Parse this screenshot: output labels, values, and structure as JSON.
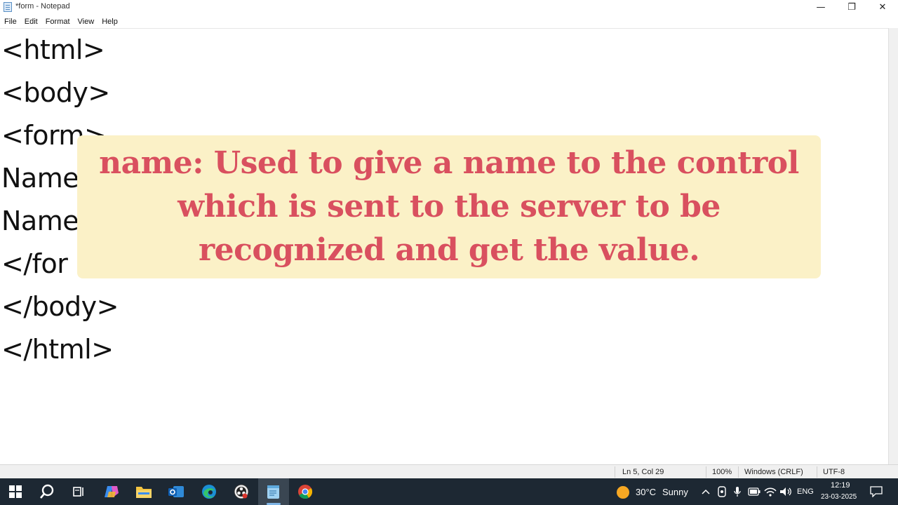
{
  "window": {
    "title": "*form - Notepad",
    "minimize_glyph": "—",
    "restore_glyph": "❐",
    "close_glyph": "✕"
  },
  "menu": {
    "items": [
      "File",
      "Edit",
      "Format",
      "View",
      "Help"
    ]
  },
  "editor": {
    "lines": [
      "<html>",
      "<body>",
      "<form>",
      "Name",
      "Name",
      "</for",
      "</body>",
      "</html>"
    ]
  },
  "overlay": {
    "text": "name: Used to give a name to the control which is sent to the server to be recognized and get the value."
  },
  "statusbar": {
    "position": "Ln 5, Col 29",
    "zoom": "100%",
    "line_ending": "Windows (CRLF)",
    "encoding": "UTF-8"
  },
  "taskbar": {
    "icons": [
      "windows-start-icon",
      "search-icon",
      "task-view-icon",
      "copilot-icon",
      "file-explorer-icon",
      "outlook-icon",
      "edge-icon",
      "obs-icon",
      "notepad-icon",
      "chrome-icon"
    ],
    "weather_temp": "30°C",
    "weather_text": "Sunny",
    "language": "ENG",
    "time": "12:19",
    "date": "23-03-2025"
  },
  "colors": {
    "overlay_bg": "#fbf1c7",
    "overlay_text": "#d9505f",
    "taskbar_bg": "#1d2833"
  }
}
